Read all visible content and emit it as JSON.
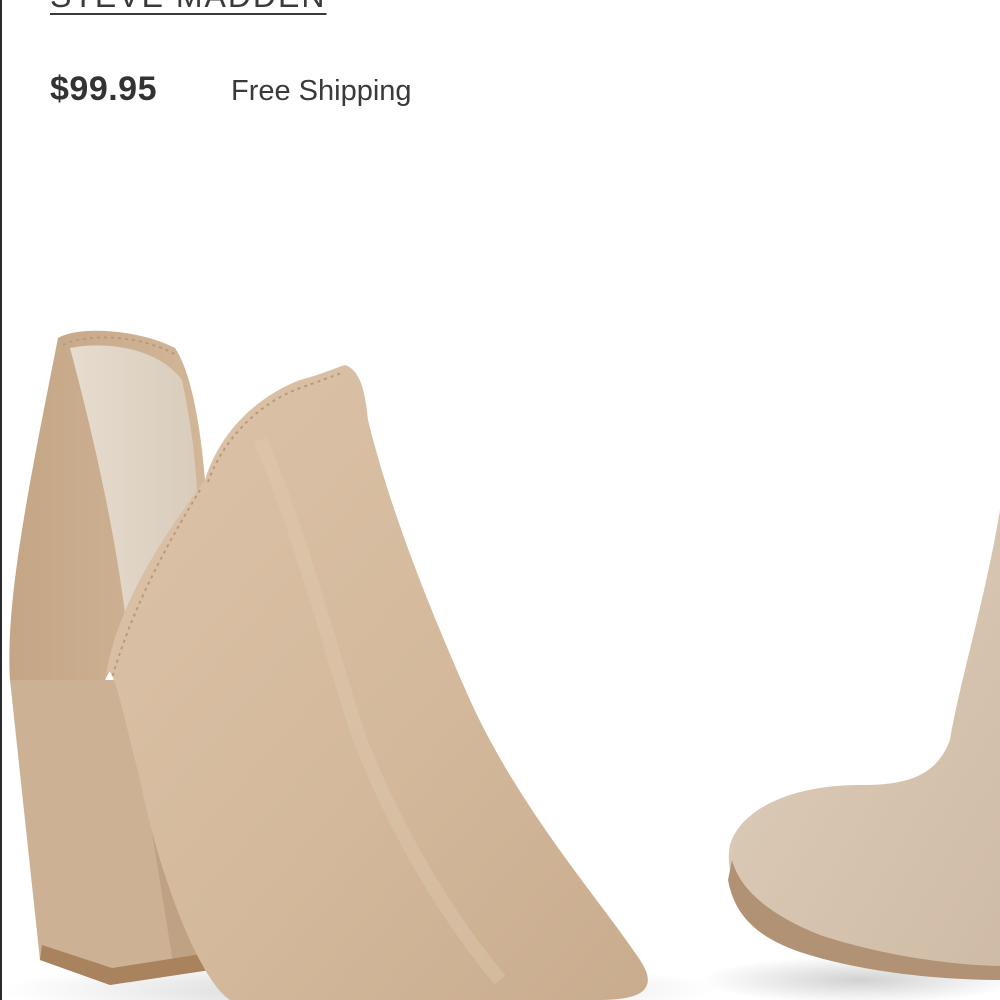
{
  "product": {
    "brand": "STEVE MADDEN",
    "price": "$99.95",
    "shipping": "Free Shipping"
  },
  "image": {
    "subject": "suede-ankle-bootie-pair",
    "color": "#d6bca0"
  }
}
